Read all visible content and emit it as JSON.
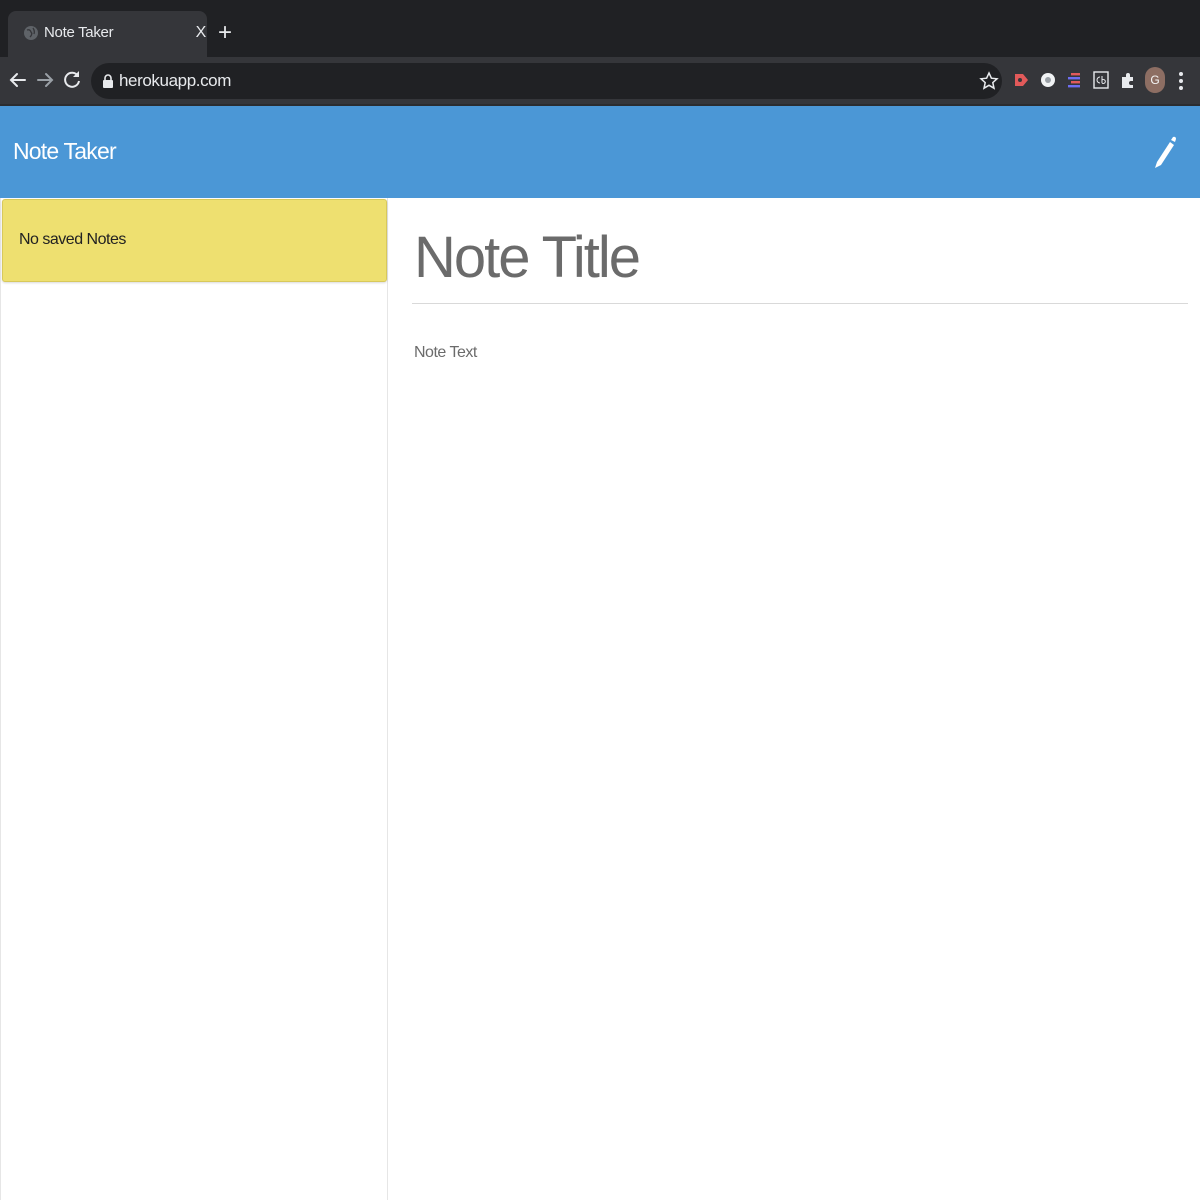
{
  "browser": {
    "tab_title": "Note Taker",
    "tab_close": "X",
    "new_tab": "+",
    "url": "herokuapp.com",
    "profile_initial": "G"
  },
  "app": {
    "brand": "Note Taker",
    "sidebar": {
      "empty_message": "No saved Notes"
    },
    "editor": {
      "title_placeholder": "Note Title",
      "text_placeholder": "Note Text"
    },
    "icons": {
      "new_note": "pencil-icon"
    },
    "colors": {
      "navbar": "#4b97d6",
      "empty_notice": "#eee070",
      "placeholder_text": "#6b6b6b"
    }
  }
}
